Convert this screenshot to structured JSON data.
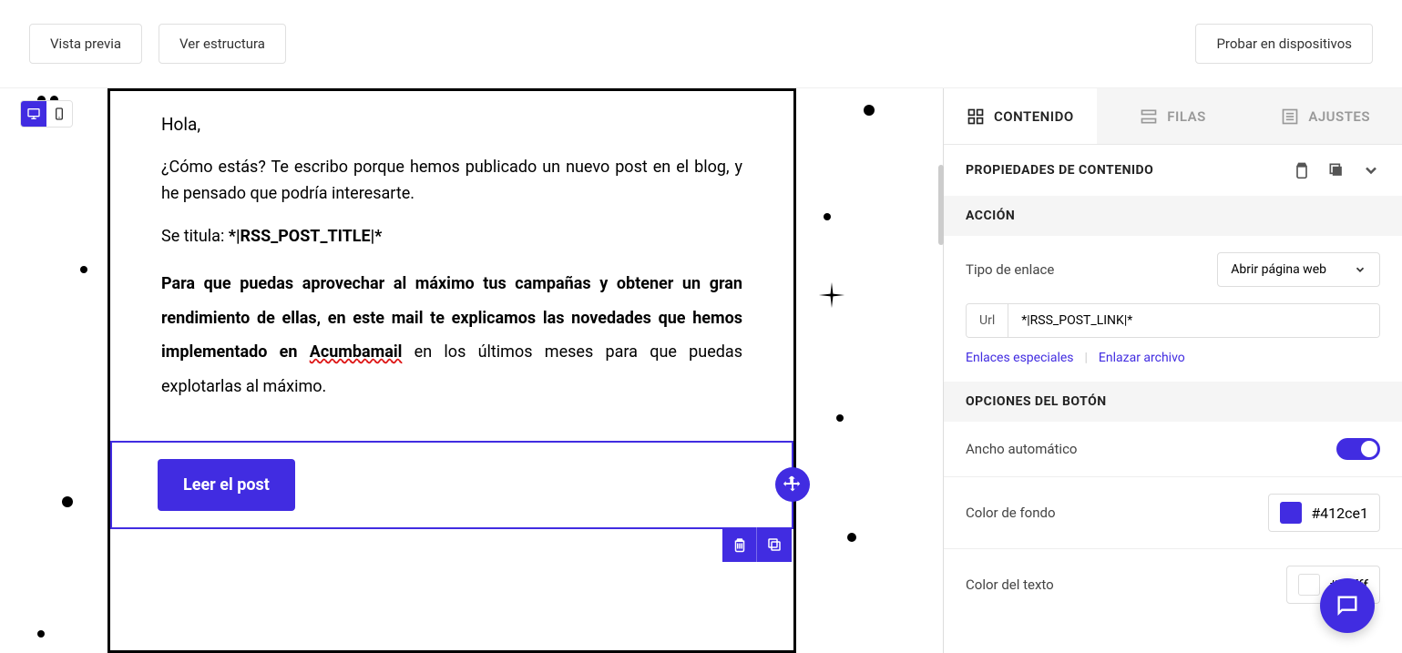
{
  "topbar": {
    "preview": "Vista previa",
    "structure": "Ver estructura",
    "test": "Probar en dispositivos"
  },
  "email": {
    "greeting": "Hola,",
    "intro": "¿Cómo estás? Te escribo porque hemos publicado un nuevo post en el blog, y he pensado que podría interesarte.",
    "title_prefix": "Se titula: ",
    "rss_title": "*|RSS_POST_TITLE|*",
    "bold1": "Para que puedas aprovechar al máximo tus campañas y obtener un gran rendimiento de ellas, en este mail te explicamos las novedades que hemos implementado en ",
    "acumba": "Acumbamail",
    "bold2": " en los últimos meses para que puedas explotarlas al máximo.",
    "button": "Leer el post"
  },
  "tabs": {
    "content": "CONTENIDO",
    "rows": "FILAS",
    "settings": "AJUSTES"
  },
  "panel": {
    "title": "PROPIEDADES DE CONTENIDO",
    "action_section": "ACCIÓN",
    "link_type_label": "Tipo de enlace",
    "link_type_value": "Abrir página web",
    "url_label": "Url",
    "url_value": "*|RSS_POST_LINK|*",
    "special_links": "Enlaces especiales",
    "link_file": "Enlazar archivo",
    "button_section": "OPCIONES DEL BOTÓN",
    "auto_width": "Ancho automático",
    "bg_color_label": "Color de fondo",
    "bg_color_value": "#412ce1",
    "text_color_label": "Color del texto",
    "text_color_value": "#ffffff"
  }
}
